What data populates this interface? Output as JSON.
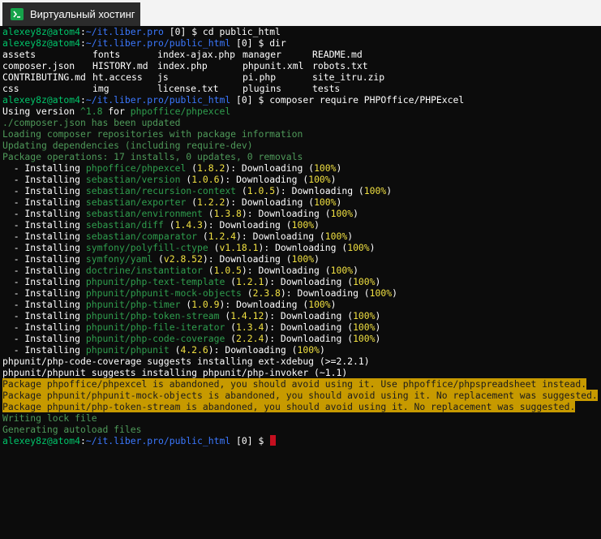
{
  "tab": {
    "title": "Виртуальный хостинг",
    "icon": "terminal-icon"
  },
  "prompts": {
    "user": "alexey8z@atom4",
    "sep": ":",
    "path_home": "~/it.liber.pro",
    "path_public": "~/it.liber.pro/public_html",
    "job": " [0] ",
    "sym": "$"
  },
  "commands": {
    "cd": " cd public_html",
    "dir": " dir",
    "composer": " composer require PHPOffice/PHPExcel"
  },
  "dir_listing": [
    [
      "assets",
      "fonts",
      "index-ajax.php",
      "manager",
      "README.md"
    ],
    [
      "composer.json",
      "HISTORY.md",
      "index.php",
      "phpunit.xml",
      "robots.txt"
    ],
    [
      "CONTRIBUTING.md",
      "ht.access",
      "js",
      "pi.php",
      "site_itru.zip"
    ],
    [
      "css",
      "img",
      "license.txt",
      "plugins",
      "tests"
    ]
  ],
  "using_version": {
    "prefix": "Using version ",
    "version": "^1.8",
    "mid": " for ",
    "pkg": "phpoffice/phpexcel"
  },
  "info_lines": [
    "./composer.json has been updated",
    "Loading composer repositories with package information",
    "Updating dependencies (including require-dev)",
    "Package operations: 17 installs, 0 updates, 0 removals"
  ],
  "installs": [
    {
      "pkg": "phpoffice/phpexcel",
      "ver": "1.8.2"
    },
    {
      "pkg": "sebastian/version",
      "ver": "1.0.6"
    },
    {
      "pkg": "sebastian/recursion-context",
      "ver": "1.0.5"
    },
    {
      "pkg": "sebastian/exporter",
      "ver": "1.2.2"
    },
    {
      "pkg": "sebastian/environment",
      "ver": "1.3.8"
    },
    {
      "pkg": "sebastian/diff",
      "ver": "1.4.3"
    },
    {
      "pkg": "sebastian/comparator",
      "ver": "1.2.4"
    },
    {
      "pkg": "symfony/polyfill-ctype",
      "ver": "v1.18.1"
    },
    {
      "pkg": "symfony/yaml",
      "ver": "v2.8.52"
    },
    {
      "pkg": "doctrine/instantiator",
      "ver": "1.0.5"
    },
    {
      "pkg": "phpunit/php-text-template",
      "ver": "1.2.1"
    },
    {
      "pkg": "phpunit/phpunit-mock-objects",
      "ver": "2.3.8"
    },
    {
      "pkg": "phpunit/php-timer",
      "ver": "1.0.9"
    },
    {
      "pkg": "phpunit/php-token-stream",
      "ver": "1.4.12"
    },
    {
      "pkg": "phpunit/php-file-iterator",
      "ver": "1.3.4"
    },
    {
      "pkg": "phpunit/php-code-coverage",
      "ver": "2.2.4"
    },
    {
      "pkg": "phpunit/phpunit",
      "ver": "4.2.6"
    }
  ],
  "install_words": {
    "prefix": "  - Installing ",
    "downloading": "Downloading",
    "pct": "100%"
  },
  "suggests": [
    "phpunit/php-code-coverage suggests installing ext-xdebug (>=2.2.1)",
    "phpunit/phpunit suggests installing phpunit/php-invoker (~1.1)"
  ],
  "warnings": [
    "Package phpoffice/phpexcel is abandoned, you should avoid using it. Use phpoffice/phpspreadsheet instead.",
    "Package phpunit/phpunit-mock-objects is abandoned, you should avoid using it. No replacement was suggested.",
    "Package phpunit/php-token-stream is abandoned, you should avoid using it. No replacement was suggested."
  ],
  "tail_lines": [
    "Writing lock file",
    "Generating autoload files"
  ],
  "colors": {
    "terminal_bg": "#0c0c0c",
    "prompt_user": "#00c46a",
    "prompt_path": "#3b78ff",
    "package": "#2f9e4e",
    "version": "#f0e041",
    "warning_bg": "#c79a00",
    "cursor": "#c50f1f"
  }
}
